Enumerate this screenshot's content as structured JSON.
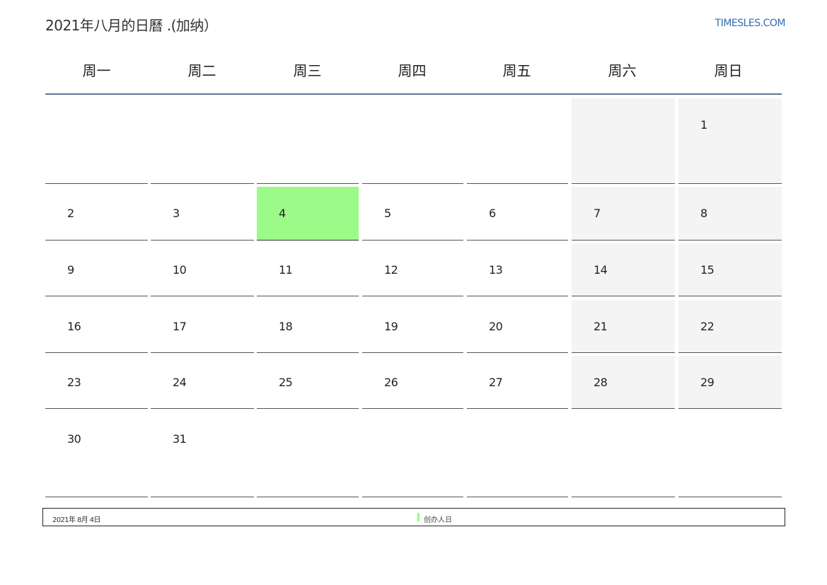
{
  "header": {
    "title": "2021年八月的日曆 .(加纳）",
    "site": "TIMESLES.COM"
  },
  "weekdays": [
    "周一",
    "周二",
    "周三",
    "周四",
    "周五",
    "周六",
    "周日"
  ],
  "weeks": [
    [
      "",
      "",
      "",
      "",
      "",
      "",
      "1"
    ],
    [
      "2",
      "3",
      "4",
      "5",
      "6",
      "7",
      "8"
    ],
    [
      "9",
      "10",
      "11",
      "12",
      "13",
      "14",
      "15"
    ],
    [
      "16",
      "17",
      "18",
      "19",
      "20",
      "21",
      "22"
    ],
    [
      "23",
      "24",
      "25",
      "26",
      "27",
      "28",
      "29"
    ],
    [
      "30",
      "31",
      "",
      "",
      "",
      "",
      ""
    ]
  ],
  "today": "4",
  "legend": {
    "date_text": "2021年 8月 4日",
    "label": "创办人日",
    "swatch_color": "#9cfa88"
  },
  "colors": {
    "weekend_bg": "#f4f4f4",
    "highlight": "#9cfa88",
    "header_rule": "#5a7896",
    "site_link": "#2f6fb5"
  }
}
